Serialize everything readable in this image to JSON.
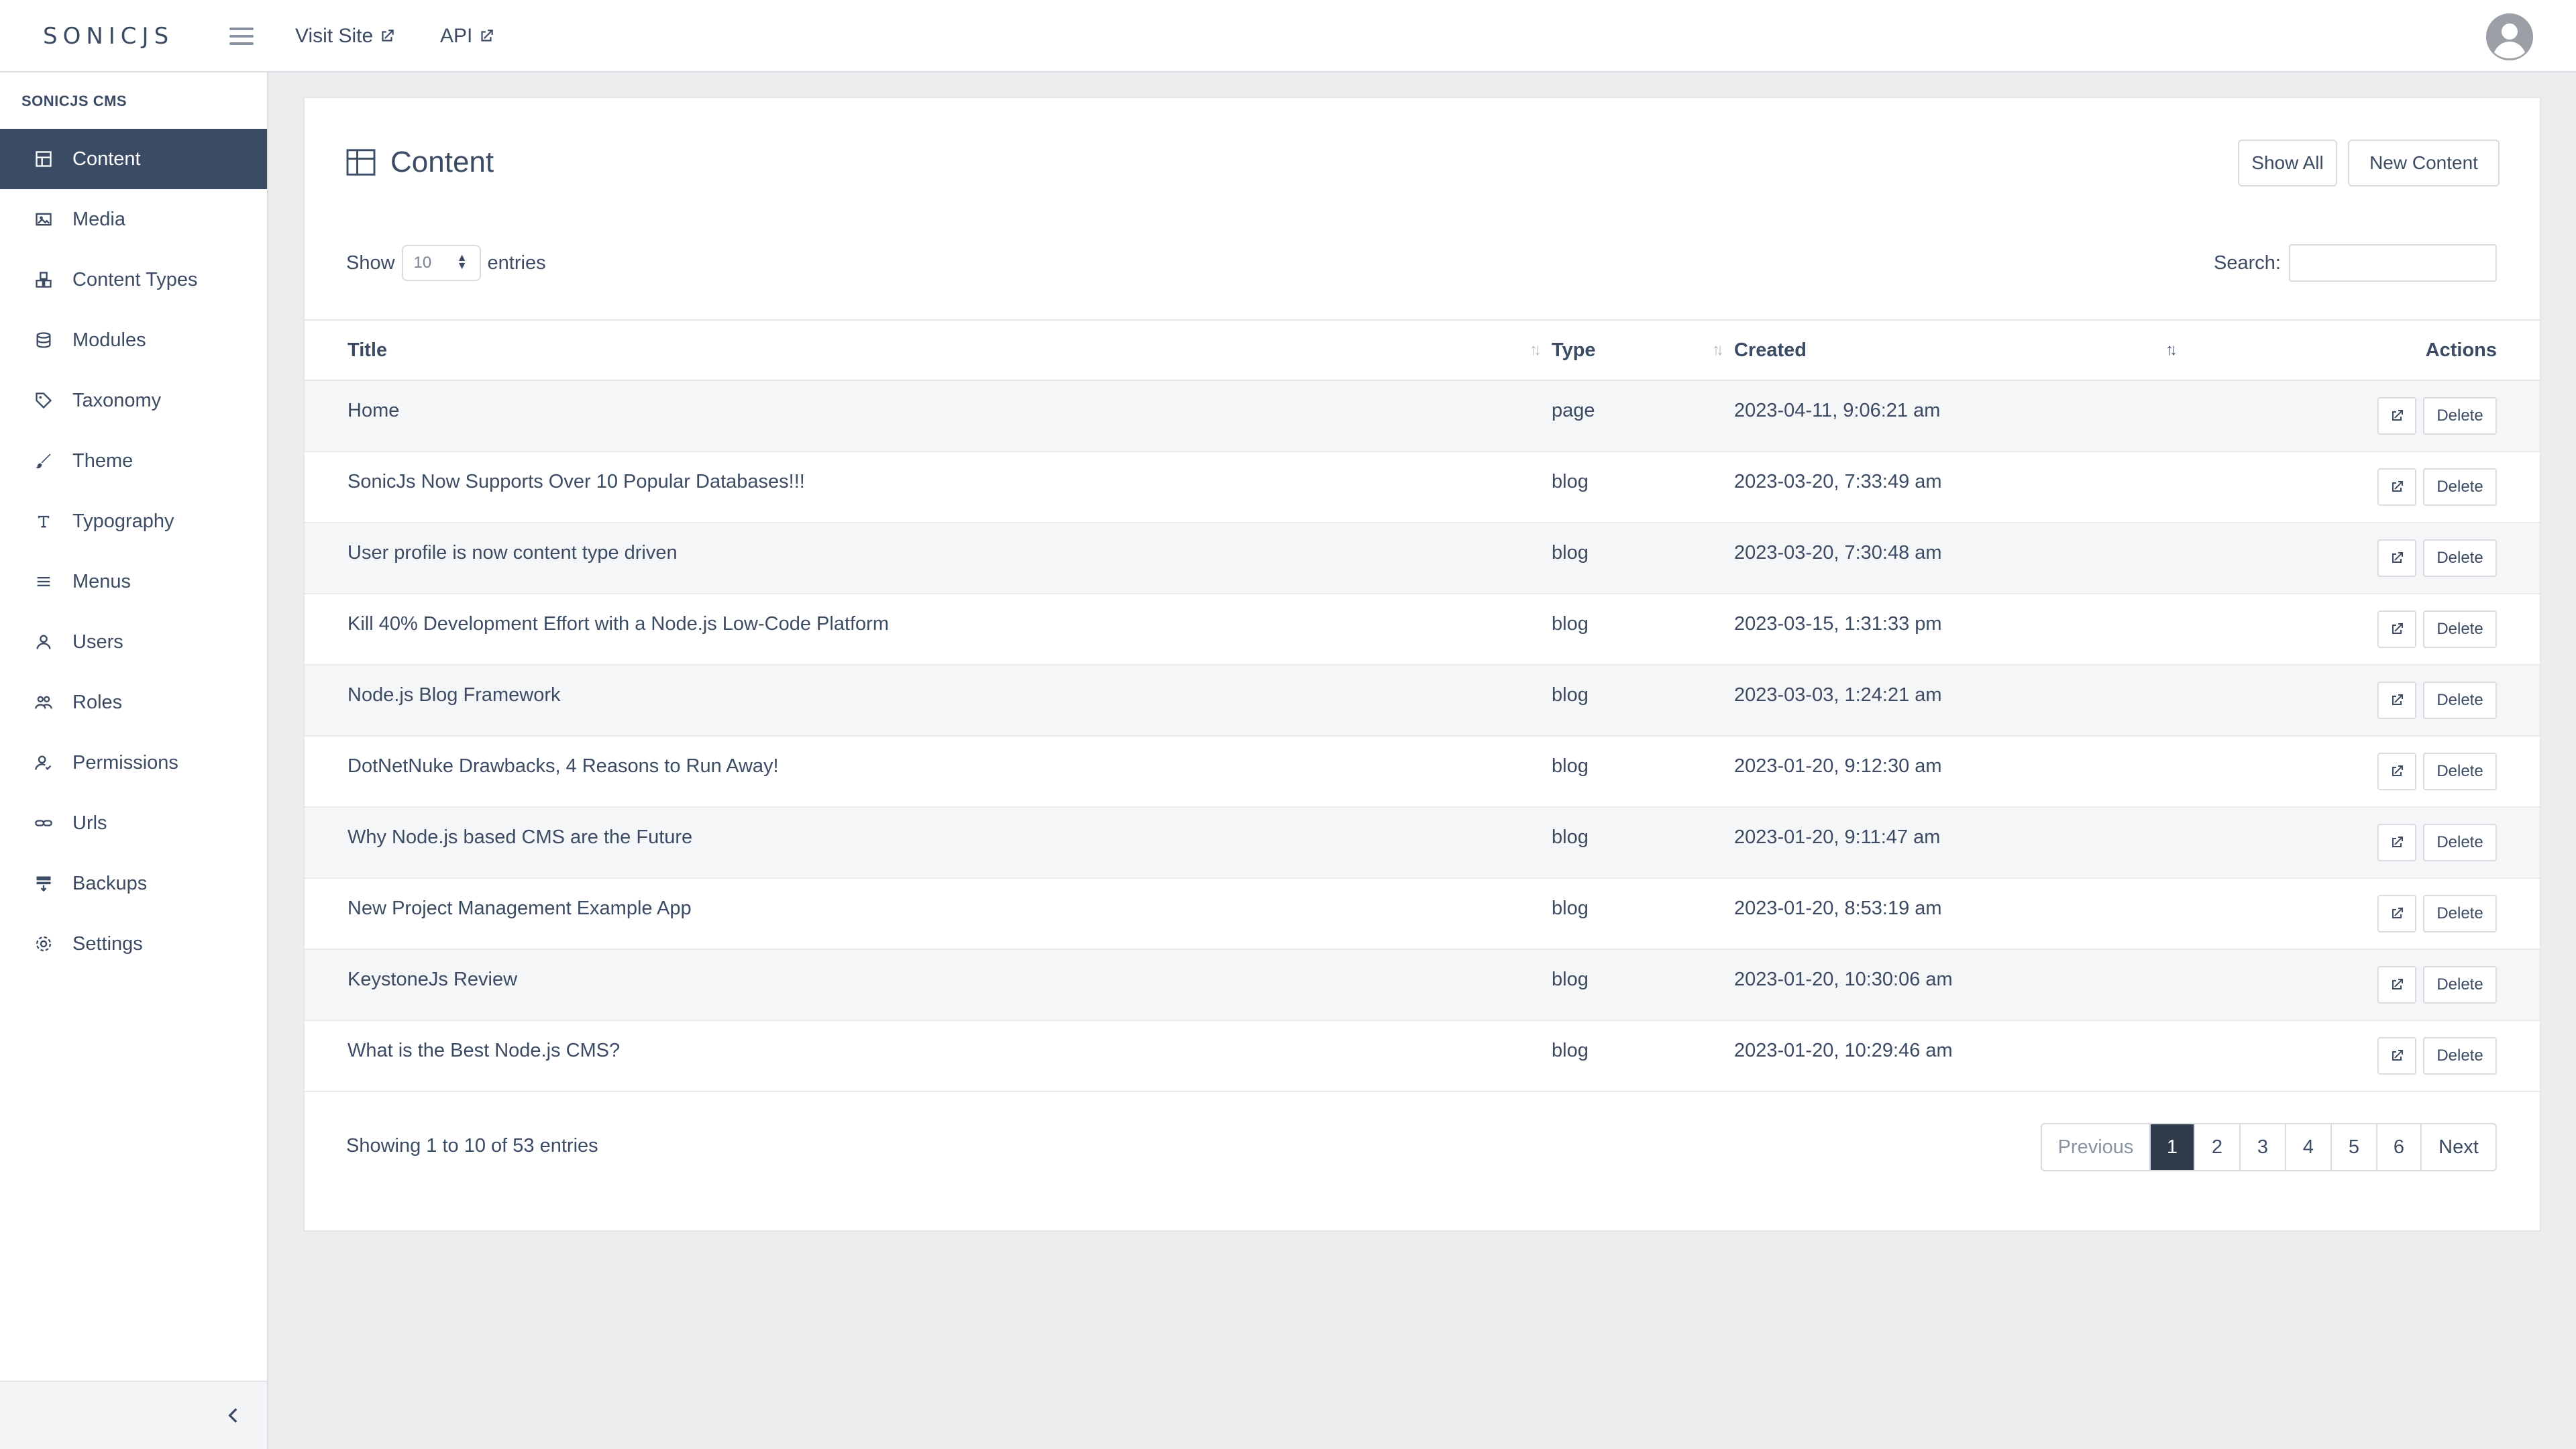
{
  "header": {
    "logo_text": "SONICJS",
    "links": [
      {
        "label": "Visit Site"
      },
      {
        "label": "API"
      }
    ]
  },
  "sidebar": {
    "title": "SONICJS CMS",
    "items": [
      {
        "label": "Content",
        "icon": "layout-icon",
        "active": true
      },
      {
        "label": "Media",
        "icon": "image-icon"
      },
      {
        "label": "Content Types",
        "icon": "cubes-icon"
      },
      {
        "label": "Modules",
        "icon": "stack-icon"
      },
      {
        "label": "Taxonomy",
        "icon": "tag-icon"
      },
      {
        "label": "Theme",
        "icon": "brush-icon"
      },
      {
        "label": "Typography",
        "icon": "text-icon"
      },
      {
        "label": "Menus",
        "icon": "list-icon"
      },
      {
        "label": "Users",
        "icon": "user-icon"
      },
      {
        "label": "Roles",
        "icon": "people-icon"
      },
      {
        "label": "Permissions",
        "icon": "user-check-icon"
      },
      {
        "label": "Urls",
        "icon": "link-icon"
      },
      {
        "label": "Backups",
        "icon": "database-icon"
      },
      {
        "label": "Settings",
        "icon": "gear-icon"
      }
    ]
  },
  "main": {
    "title": "Content",
    "show_all_label": "Show All",
    "new_content_label": "New Content",
    "show_label": "Show",
    "page_size": "10",
    "entries_label": "entries",
    "search_label": "Search:",
    "search_value": "",
    "columns": [
      "Title",
      "Type",
      "Created",
      "Actions"
    ],
    "rows": [
      {
        "title": "Home",
        "type": "page",
        "created": "2023-04-11, 9:06:21 am"
      },
      {
        "title": "SonicJs Now Supports Over 10 Popular Databases!!!",
        "type": "blog",
        "created": "2023-03-20, 7:33:49 am"
      },
      {
        "title": "User profile is now content type driven",
        "type": "blog",
        "created": "2023-03-20, 7:30:48 am"
      },
      {
        "title": "Kill 40% Development Effort with a Node.js Low-Code Platform",
        "type": "blog",
        "created": "2023-03-15, 1:31:33 pm"
      },
      {
        "title": "Node.js Blog Framework",
        "type": "blog",
        "created": "2023-03-03, 1:24:21 am"
      },
      {
        "title": "DotNetNuke Drawbacks, 4 Reasons to Run Away!",
        "type": "blog",
        "created": "2023-01-20, 9:12:30 am"
      },
      {
        "title": "Why Node.js based CMS are the Future",
        "type": "blog",
        "created": "2023-01-20, 9:11:47 am"
      },
      {
        "title": "New Project Management Example App",
        "type": "blog",
        "created": "2023-01-20, 8:53:19 am"
      },
      {
        "title": "KeystoneJs Review",
        "type": "blog",
        "created": "2023-01-20, 10:30:06 am"
      },
      {
        "title": "What is the Best Node.js CMS?",
        "type": "blog",
        "created": "2023-01-20, 10:29:46 am"
      }
    ],
    "delete_label": "Delete",
    "info_text": "Showing 1 to 10 of 53 entries",
    "pagination": {
      "previous": "Previous",
      "pages": [
        "1",
        "2",
        "3",
        "4",
        "5",
        "6"
      ],
      "current": "1",
      "next": "Next"
    }
  },
  "colors": {
    "accent": "#3c4b64",
    "active_page": "#2f3a4a"
  }
}
